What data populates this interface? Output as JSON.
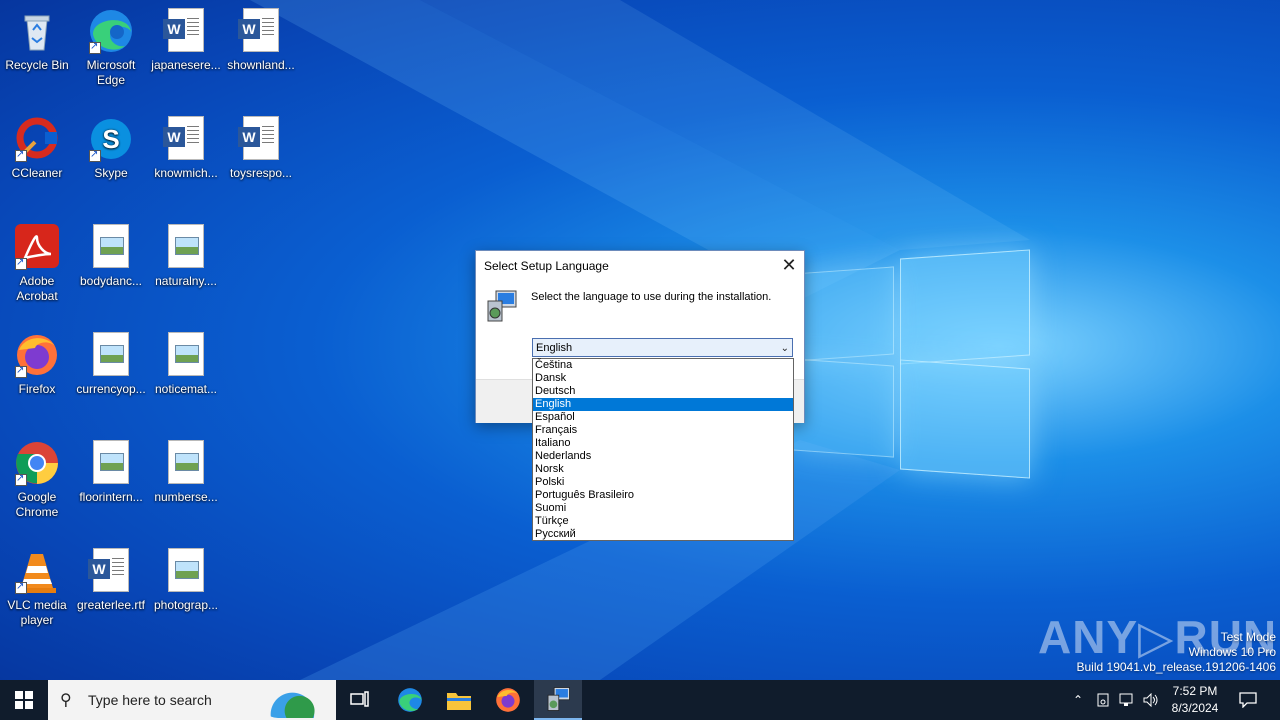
{
  "desktop": {
    "icons": [
      {
        "label": "Recycle Bin"
      },
      {
        "label": "Microsoft Edge"
      },
      {
        "label": "japanesere..."
      },
      {
        "label": "shownland..."
      },
      {
        "label": "CCleaner"
      },
      {
        "label": "Skype"
      },
      {
        "label": "knowmich..."
      },
      {
        "label": "toysrespo..."
      },
      {
        "label": "Adobe Acrobat"
      },
      {
        "label": "bodydanc..."
      },
      {
        "label": "naturalny...."
      },
      {
        "label": "Firefox"
      },
      {
        "label": "currencyop..."
      },
      {
        "label": "noticemat..."
      },
      {
        "label": "Google Chrome"
      },
      {
        "label": "floorintern..."
      },
      {
        "label": "numberse..."
      },
      {
        "label": "VLC media player"
      },
      {
        "label": "greaterlee.rtf"
      },
      {
        "label": "photograp..."
      }
    ]
  },
  "dialog": {
    "title": "Select Setup Language",
    "close_glyph": "✕",
    "message": "Select the language to use during the installation.",
    "selected_value": "English",
    "options": [
      "Čeština",
      "Dansk",
      "Deutsch",
      "English",
      "Español",
      "Français",
      "Italiano",
      "Nederlands",
      "Norsk",
      "Polski",
      "Português Brasileiro",
      "Suomi",
      "Türkçe",
      "Русский"
    ],
    "selected_index": 3
  },
  "watermark": {
    "brand": "ANY▷RUN",
    "line1": "Test Mode",
    "line2": "Windows 10 Pro",
    "line3": "Build 19041.vb_release.191206-1406"
  },
  "taskbar": {
    "search_placeholder": "Type here to search",
    "time": "7:52 PM",
    "date": "8/3/2024"
  },
  "colors": {
    "accent": "#0078d7",
    "taskbar": "#101c2c",
    "word_blue": "#2b579a"
  }
}
